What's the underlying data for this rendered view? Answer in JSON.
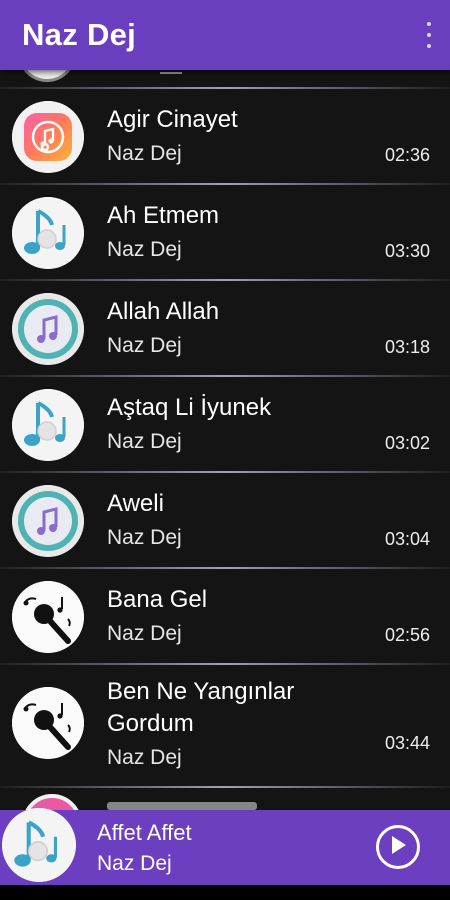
{
  "appbar": {
    "title": "Naz Dej",
    "menu_icon": "more-vert-icon"
  },
  "songs": [
    {
      "title": "Agir Cinayet",
      "artist": "Naz Dej",
      "duration": "02:36",
      "art": "itunes-icon"
    },
    {
      "title": "Ah Etmem",
      "artist": "Naz Dej",
      "duration": "03:30",
      "art": "music-note-icon"
    },
    {
      "title": "Allah Allah",
      "artist": "Naz Dej",
      "duration": "03:18",
      "art": "music-badge-icon"
    },
    {
      "title": "Aştaq Li İyunek",
      "artist": "Naz Dej",
      "duration": "03:02",
      "art": "music-note-icon"
    },
    {
      "title": "Aweli",
      "artist": "Naz Dej",
      "duration": "03:04",
      "art": "music-badge-icon"
    },
    {
      "title": "Bana Gel",
      "artist": "Naz Dej",
      "duration": "02:56",
      "art": "microphone-icon"
    },
    {
      "title": "Ben Ne Yangınlar Gordum",
      "title_line1": "Ben Ne Yangınlar",
      "title_line2": "Gordum",
      "artist": "Naz Dej",
      "duration": "03:44",
      "art": "microphone-icon"
    }
  ],
  "player": {
    "title": "Affet Affet",
    "artist": "Naz Dej",
    "play_icon": "play-icon",
    "art": "music-note-icon"
  },
  "colors": {
    "accent": "#6a3fbf",
    "background": "#141414"
  }
}
